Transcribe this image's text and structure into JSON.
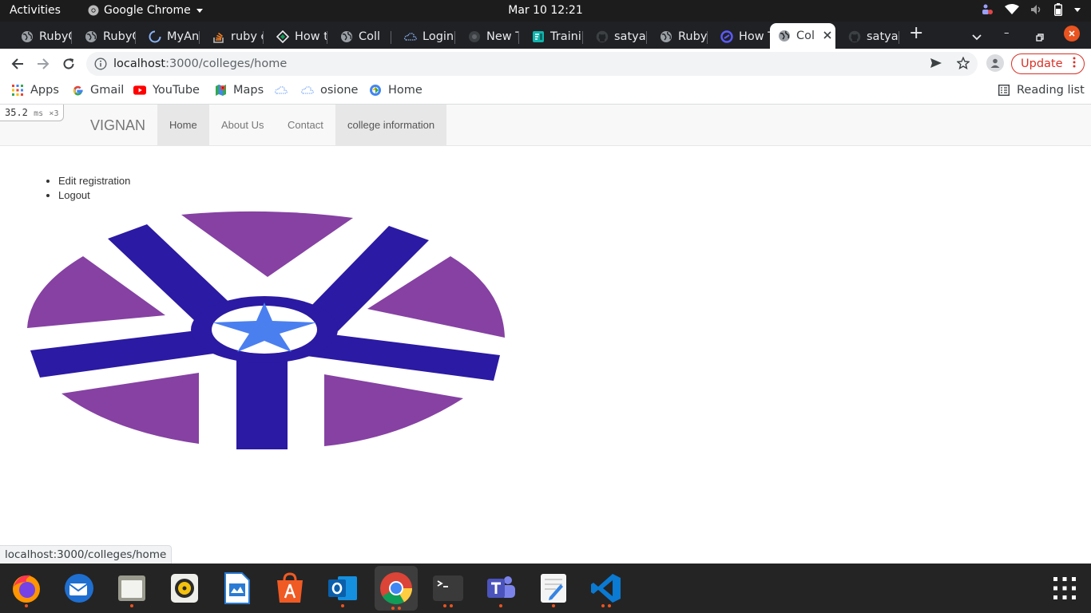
{
  "system": {
    "activities": "Activities",
    "app_name": "Google Chrome",
    "datetime": "Mar 10  12:21"
  },
  "tabs": [
    {
      "title": "RubyC",
      "icon": "globe-icon"
    },
    {
      "title": "RubyC",
      "icon": "globe-icon"
    },
    {
      "title": "MyAn",
      "icon": "spinner-icon"
    },
    {
      "title": "ruby c",
      "icon": "stackoverflow-icon"
    },
    {
      "title": "How t",
      "icon": "diamond-icon"
    },
    {
      "title": "Coll",
      "icon": "globe-icon"
    },
    {
      "title": "Login",
      "icon": "cloud-icon"
    },
    {
      "title": "New T",
      "icon": "chrome-newtab-icon"
    },
    {
      "title": "Traini",
      "icon": "forms-icon"
    },
    {
      "title": "satyal",
      "icon": "github-icon"
    },
    {
      "title": "RubyC",
      "icon": "globe-icon"
    },
    {
      "title": "How T",
      "icon": "circle-logo-icon"
    },
    {
      "title": "Col",
      "icon": "globe-icon",
      "active": true
    },
    {
      "title": "satyal",
      "icon": "github-icon"
    }
  ],
  "toolbar": {
    "url_host": "localhost",
    "url_path": ":3000/colleges/home",
    "update_label": "Update"
  },
  "bookmarks": [
    {
      "label": "Apps",
      "icon": "apps-grid-icon"
    },
    {
      "label": "Gmail",
      "icon": "google-icon"
    },
    {
      "label": "YouTube",
      "icon": "youtube-icon"
    },
    {
      "label": "Maps",
      "icon": "maps-icon"
    },
    {
      "label": "",
      "icon": "cloud-icon"
    },
    {
      "label": "osione",
      "icon": "cloud-icon"
    },
    {
      "label": "Home",
      "icon": "home-site-icon"
    }
  ],
  "reading_list": "Reading list",
  "page": {
    "profiler_time": "35.2",
    "profiler_unit": "ms",
    "profiler_count": "×3",
    "brand": "VIGNAN",
    "nav": [
      {
        "label": "Home",
        "active": true
      },
      {
        "label": "About Us"
      },
      {
        "label": "Contact"
      },
      {
        "label": "college information"
      }
    ],
    "user_links": [
      "Edit registration",
      "Logout"
    ],
    "logo_colors": {
      "purple": "#8641a3",
      "blue": "#2b1aa3",
      "star": "#4a7ff0"
    }
  },
  "status_url": "localhost:3000/colleges/home",
  "dock": [
    {
      "name": "firefox-icon"
    },
    {
      "name": "thunderbird-icon"
    },
    {
      "name": "files-icon"
    },
    {
      "name": "rhythmbox-icon"
    },
    {
      "name": "libreoffice-writer-icon"
    },
    {
      "name": "app-store-icon"
    },
    {
      "name": "outlook-icon"
    },
    {
      "name": "chrome-icon"
    },
    {
      "name": "terminal-icon"
    },
    {
      "name": "teams-icon"
    },
    {
      "name": "text-editor-icon"
    },
    {
      "name": "vscode-icon"
    }
  ]
}
